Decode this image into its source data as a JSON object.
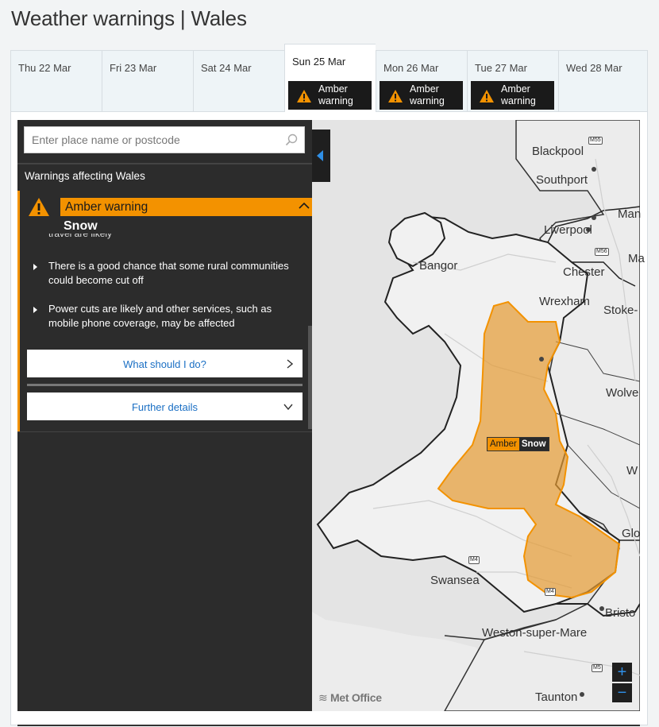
{
  "title": "Weather warnings | Wales",
  "tabs": [
    {
      "day": "Thu 22 Mar",
      "badge": ""
    },
    {
      "day": "Fri 23 Mar",
      "badge": ""
    },
    {
      "day": "Sat 24 Mar",
      "badge": ""
    },
    {
      "day": "Sun 25 Mar",
      "badge": "Amber warning",
      "badge_l1": "Amber",
      "badge_l2": "warning",
      "active": true
    },
    {
      "day": "Mon 26 Mar",
      "badge": "Amber warning",
      "badge_l1": "Amber",
      "badge_l2": "warning"
    },
    {
      "day": "Tue 27 Mar",
      "badge": "Amber warning",
      "badge_l1": "Amber",
      "badge_l2": "warning"
    },
    {
      "day": "Wed 28 Mar",
      "badge": ""
    }
  ],
  "search": {
    "placeholder": "Enter place name or postcode"
  },
  "sidebar": {
    "heading": "Warnings affecting Wales",
    "warning": {
      "level": "Amber warning",
      "type": "Snow",
      "cut_text": "travel are likely",
      "bullets": [
        "There is a good chance that some rural communities could become cut off",
        "Power cuts are likely and other services, such as mobile phone coverage, may be affected"
      ],
      "what_button": "What should I do?",
      "further_button": "Further details"
    }
  },
  "map": {
    "places": [
      "Blackpool",
      "Southport",
      "Liverpool",
      "Bangor",
      "Chester",
      "Wrexham",
      "Stoke-",
      "Man",
      "Ma",
      "Wolve",
      "W",
      "Glo",
      "Swansea",
      "Bristo",
      "Weston-super-Mare",
      "Taunton"
    ],
    "motorways": [
      "M55",
      "M56",
      "M4",
      "M4",
      "M5"
    ],
    "pin": {
      "level": "Amber",
      "type": "Snow"
    },
    "zoom_in": "+",
    "zoom_out": "−",
    "attribution": "Met Office"
  },
  "colors": {
    "amber": "#f39200",
    "panel": "#2c2c2c",
    "link": "#1a6fc4",
    "zoom": "#2f8fe6"
  }
}
